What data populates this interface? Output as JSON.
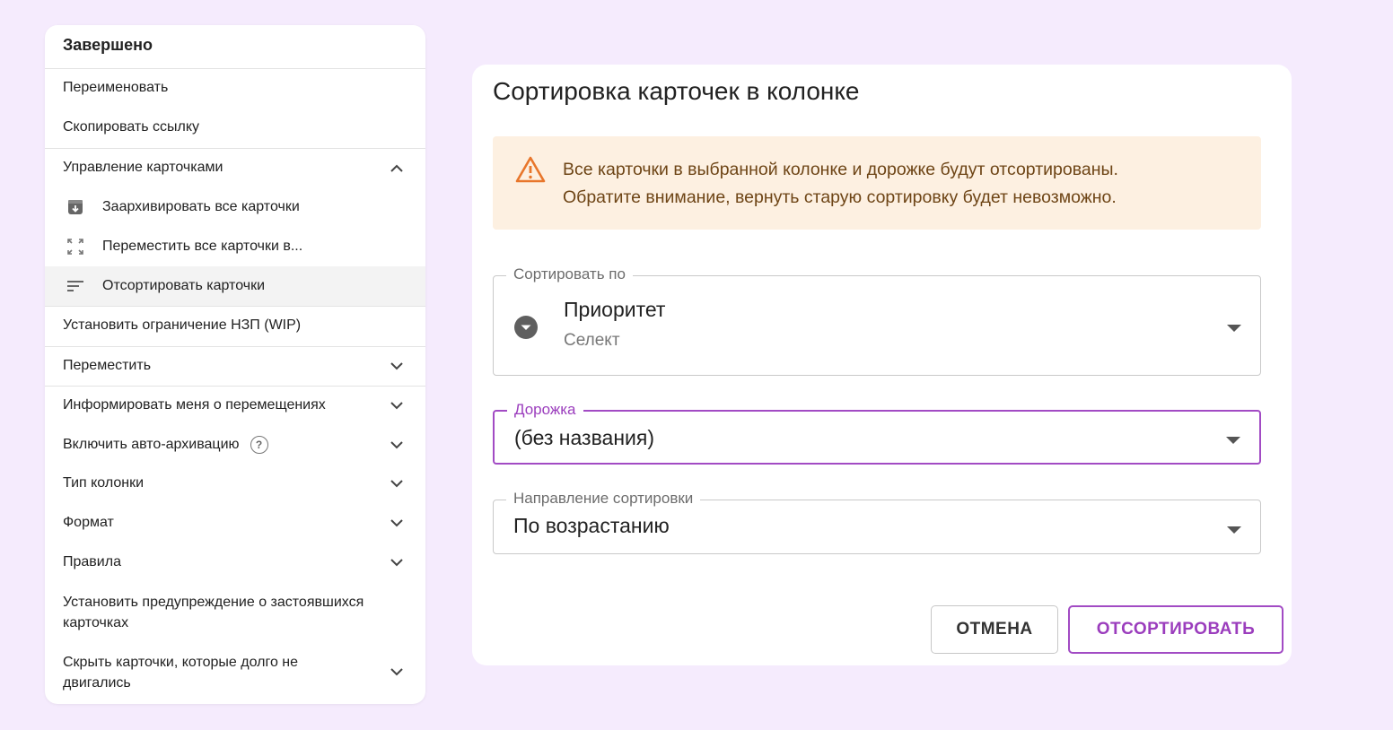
{
  "menu": {
    "title": "Завершено",
    "items": {
      "rename": "Переименовать",
      "copy_link": "Скопировать ссылку",
      "manage_cards": "Управление карточками",
      "archive_all": "Заархивировать все карточки",
      "move_all": "Переместить все карточки в...",
      "sort_cards": "Отсортировать карточки",
      "wip_limit": "Установить ограничение НЗП (WIP)",
      "move": "Переместить",
      "notify": "Информировать меня о перемещениях",
      "auto_archive": "Включить авто-архивацию",
      "column_type": "Тип колонки",
      "format": "Формат",
      "rules": "Правила",
      "stale_warning": "Установить предупреждение о застоявшихся карточках",
      "hide_cards": "Скрыть карточки, которые долго не двигались"
    },
    "help_glyph": "?"
  },
  "dialog": {
    "title": "Сортировка карточек в колонке",
    "warning": {
      "line1": "Все карточки в выбранной колонке и дорожке будут отсортированы.",
      "line2": "Обратите внимание, вернуть старую сортировку будет невозможно."
    },
    "sort_by": {
      "label": "Сортировать по",
      "value": "Приоритет",
      "sub": "Селект"
    },
    "lane": {
      "label": "Дорожка",
      "value": "(без названия)"
    },
    "direction": {
      "label": "Направление сортировки",
      "value": "По возрастанию"
    },
    "buttons": {
      "cancel": "ОТМЕНА",
      "sort": "ОТСОРТИРОВАТЬ"
    }
  },
  "colors": {
    "accent": "#a24bc4",
    "warning_bg": "#fdf0e1",
    "warning_icon": "#e8762b",
    "page_bg": "#f5ebfd"
  },
  "icons": {
    "manage_cards": "chevron-up-icon",
    "archive_all": "archive-icon",
    "move_all": "move-icon",
    "sort_cards": "sort-icon",
    "expand": "chevron-down-icon",
    "warning": "warning-icon",
    "sort_by": "priority-select-icon",
    "dropdown": "dropdown-arrow-icon"
  }
}
